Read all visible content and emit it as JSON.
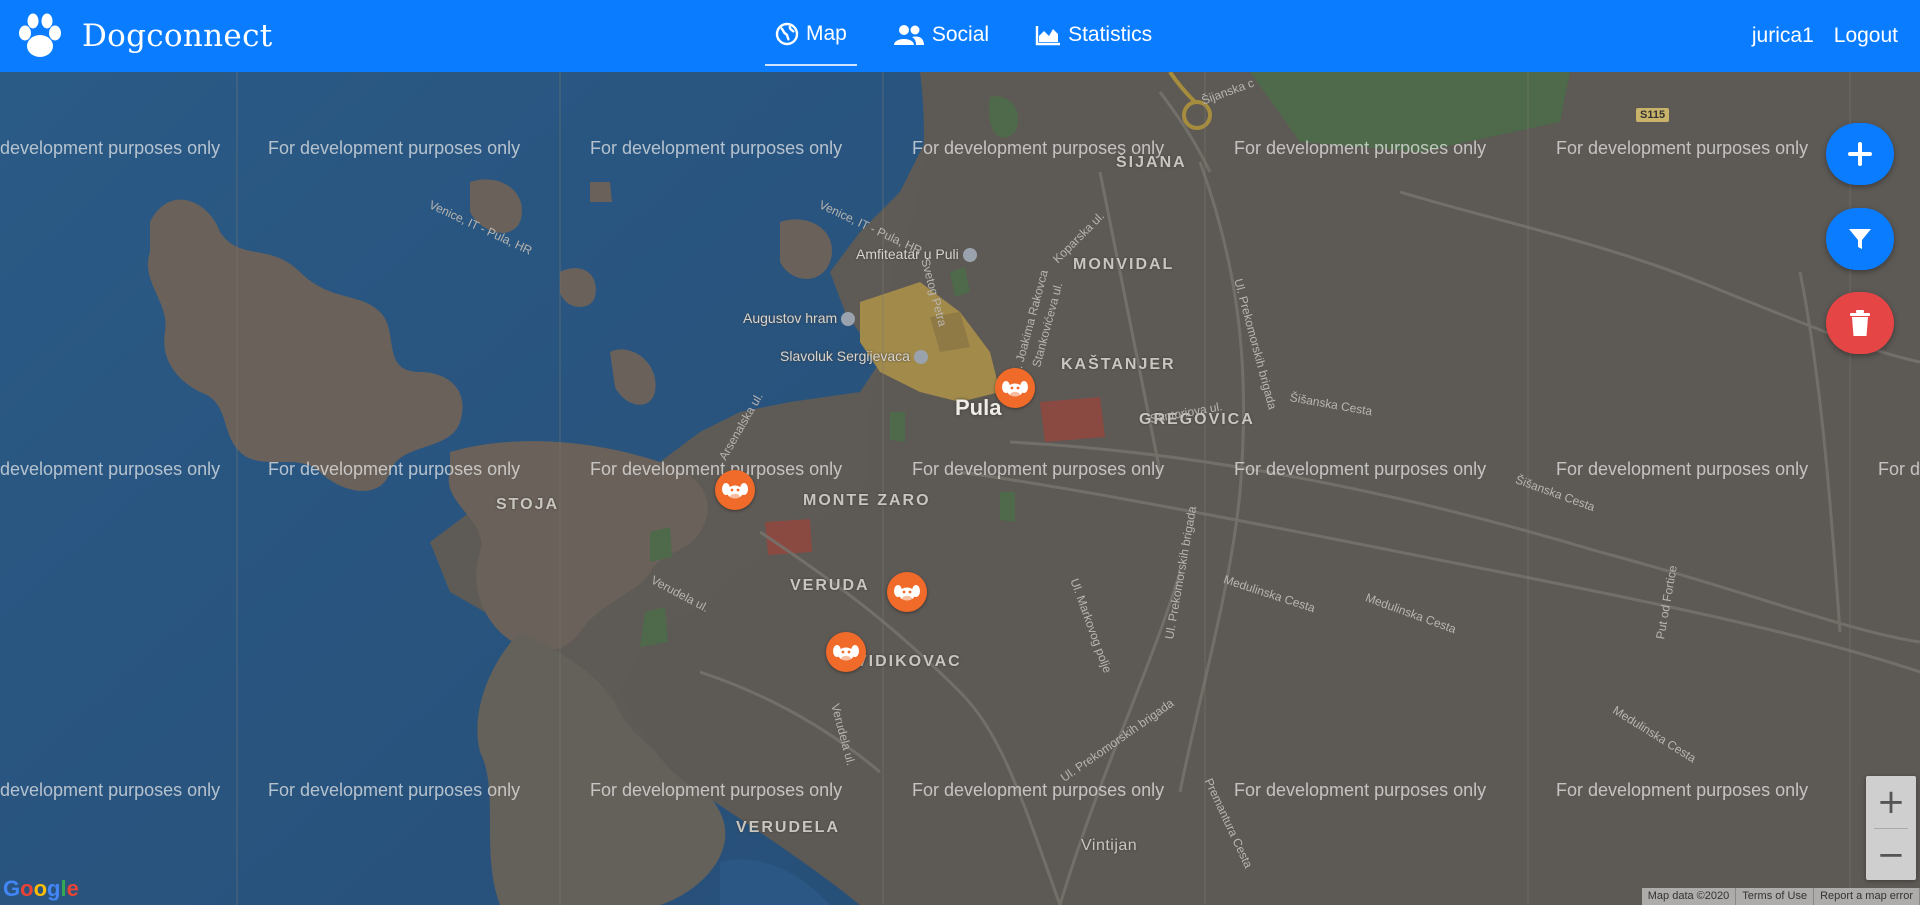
{
  "app": {
    "name": "Dogconnect"
  },
  "nav": {
    "items": [
      {
        "label": "Map",
        "icon": "globe-icon"
      },
      {
        "label": "Social",
        "icon": "users-icon"
      },
      {
        "label": "Statistics",
        "icon": "chart-area-icon"
      }
    ],
    "username": "jurica1",
    "logout": "Logout"
  },
  "map": {
    "watermark": "For development purposes only",
    "watermark_partial": "development purposes only",
    "watermark_edge": "For d",
    "city": "Pula",
    "places": [
      "ŠIJANA",
      "MONVIDAL",
      "KAŠTANJER",
      "GREGOVICA",
      "STOJA",
      "MONTE ZARO",
      "VERUDA",
      "VIDIKOVAC",
      "VERUDELA",
      "Vintijan"
    ],
    "pois": [
      "Amfiteatar u Puli",
      "Augustov hram",
      "Slavoluk Sergijevaca"
    ],
    "streets": [
      "Venice, IT - Pula, HR",
      "Šijanska c",
      "Ul. Prekomorskih brigada",
      "Šišanska Cesta",
      "Medulinska Cesta",
      "Verudela ul.",
      "Arsenalska ul.",
      "Sv. Petra",
      "Kaštanjer",
      "Santoriova ul.",
      "Ul. Markovog polje",
      "Premantura Cesta",
      "Put od Fortice",
      "Svetog Petra",
      "Koparska ul.",
      "Ul. Joakima Rakovca",
      "Stankovićeva ul."
    ],
    "road_shield": "S115",
    "attribution": [
      "Map data ©2020",
      "Terms of Use",
      "Report a map error"
    ],
    "google": "Google",
    "zoom_in": "+",
    "zoom_out": "−",
    "accent_blue": "#0a7cff",
    "danger_red": "#e64545",
    "marker_orange": "#f06a2a"
  },
  "actions": {
    "add": "plus-icon",
    "filter": "filter-icon",
    "delete": "trash-icon"
  }
}
